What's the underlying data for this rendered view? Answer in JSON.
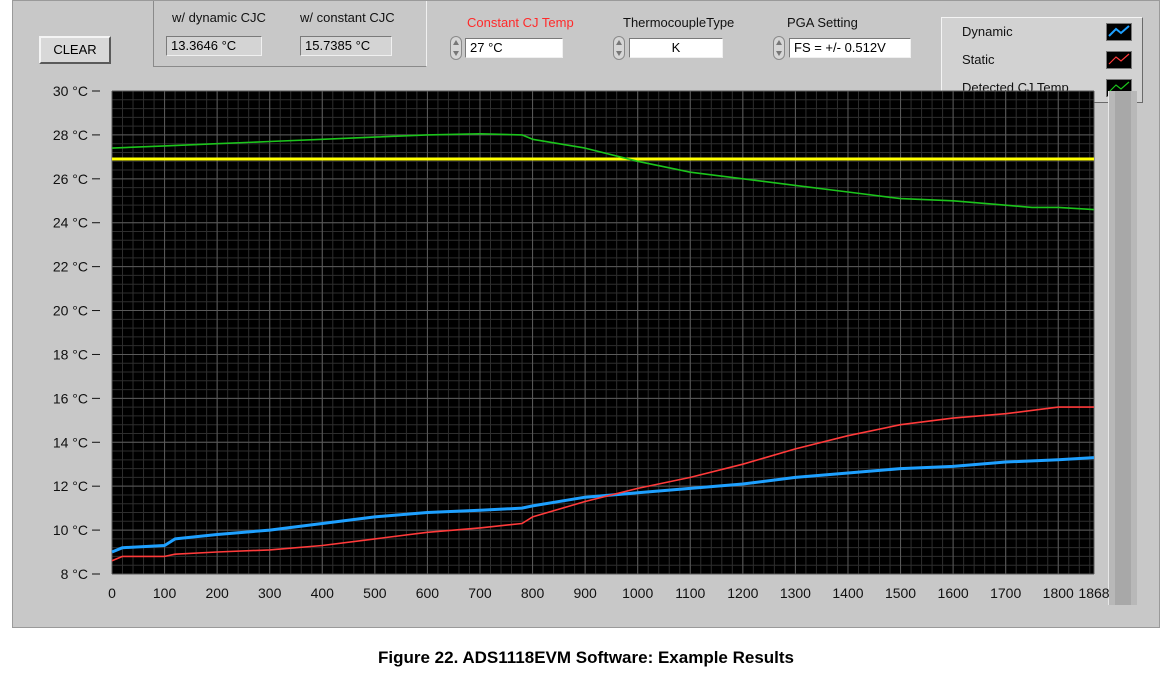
{
  "controls": {
    "clear_label": "CLEAR",
    "dynamic_label": "w/ dynamic CJC",
    "dynamic_value": "13.3646 °C",
    "constant_label": "w/ constant CJC",
    "constant_value": "15.7385 °C",
    "cj_temp_label": "Constant CJ Temp",
    "cj_temp_value": "27 °C",
    "tc_label": "ThermocoupleType",
    "tc_value": "K",
    "pga_label": "PGA Setting",
    "pga_value": "FS = +/- 0.512V"
  },
  "legend": [
    {
      "label": "Dynamic",
      "color": "#1ea0ff"
    },
    {
      "label": "Static",
      "color": "#ff3a3a"
    },
    {
      "label": "Detected CJ Temp",
      "color": "#1cc41c"
    }
  ],
  "caption": "Figure 22. ADS1118EVM Software: Example Results",
  "colors": {
    "plot_bg": "#000000",
    "grid": "#5a5a5a",
    "constant_line": "#ffff00"
  },
  "chart_data": {
    "type": "line",
    "xlim": [
      0,
      1868
    ],
    "ylim": [
      8,
      30
    ],
    "x_ticks": [
      0,
      100,
      200,
      300,
      400,
      500,
      600,
      700,
      800,
      900,
      1000,
      1100,
      1200,
      1300,
      1400,
      1500,
      1600,
      1700,
      1800,
      1868
    ],
    "y_ticks": [
      8,
      10,
      12,
      14,
      16,
      18,
      20,
      22,
      24,
      26,
      28,
      30
    ],
    "y_tick_labels": [
      "8 °C",
      "10 °C",
      "12 °C",
      "14 °C",
      "16 °C",
      "18 °C",
      "20 °C",
      "22 °C",
      "24 °C",
      "26 °C",
      "28 °C",
      "30 °C"
    ],
    "grid": true,
    "legend_position": "top-right",
    "constant_line": 26.9,
    "series": [
      {
        "name": "Dynamic",
        "color": "#1ea0ff",
        "x": [
          0,
          20,
          100,
          120,
          200,
          300,
          400,
          500,
          600,
          700,
          780,
          800,
          900,
          1000,
          1100,
          1200,
          1300,
          1400,
          1500,
          1600,
          1700,
          1800,
          1868
        ],
        "y": [
          9.0,
          9.2,
          9.3,
          9.6,
          9.8,
          10.0,
          10.3,
          10.6,
          10.8,
          10.9,
          11.0,
          11.1,
          11.5,
          11.7,
          11.9,
          12.1,
          12.4,
          12.6,
          12.8,
          12.9,
          13.1,
          13.2,
          13.3
        ]
      },
      {
        "name": "Static",
        "color": "#ff3a3a",
        "x": [
          0,
          20,
          100,
          120,
          200,
          300,
          400,
          500,
          600,
          700,
          780,
          800,
          900,
          1000,
          1100,
          1200,
          1300,
          1400,
          1500,
          1600,
          1700,
          1800,
          1868
        ],
        "y": [
          8.6,
          8.8,
          8.8,
          8.9,
          9.0,
          9.1,
          9.3,
          9.6,
          9.9,
          10.1,
          10.3,
          10.6,
          11.3,
          11.9,
          12.4,
          13.0,
          13.7,
          14.3,
          14.8,
          15.1,
          15.3,
          15.6,
          15.6
        ]
      },
      {
        "name": "Detected CJ Temp",
        "color": "#1cc41c",
        "x": [
          0,
          100,
          200,
          300,
          400,
          500,
          600,
          700,
          780,
          800,
          900,
          1000,
          1100,
          1200,
          1300,
          1400,
          1500,
          1600,
          1700,
          1750,
          1800,
          1868
        ],
        "y": [
          27.4,
          27.5,
          27.6,
          27.7,
          27.8,
          27.9,
          28.0,
          28.05,
          28.0,
          27.8,
          27.4,
          26.8,
          26.3,
          26.0,
          25.7,
          25.4,
          25.1,
          25.0,
          24.8,
          24.7,
          24.7,
          24.6
        ]
      }
    ]
  }
}
